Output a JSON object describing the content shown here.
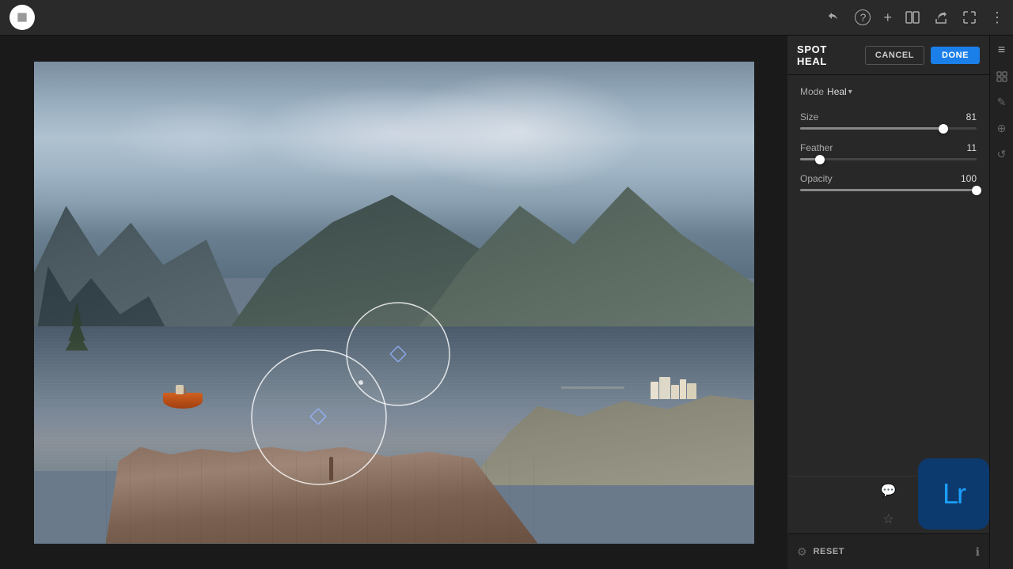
{
  "topBar": {
    "undo_icon": "↩",
    "help_icon": "?",
    "add_icon": "+",
    "compare_icon": "⊡",
    "share_icon": "↑",
    "expand_icon": "⤢",
    "more_icon": "⋮"
  },
  "panel": {
    "toolTitle": "SPOT HEAL",
    "cancelLabel": "CANCEL",
    "doneLabel": "DONE",
    "modeLabel": "Mode",
    "modeValue": "Heal",
    "controls": [
      {
        "id": "size",
        "label": "Size",
        "value": 81,
        "max": 100,
        "percent": 81
      },
      {
        "id": "feather",
        "label": "Feather",
        "value": 11,
        "max": 100,
        "percent": 11
      },
      {
        "id": "opacity",
        "label": "Opacity",
        "value": 100,
        "max": 100,
        "percent": 100
      }
    ],
    "resetLabel": "RESET"
  },
  "verticalIcons": [
    "⬡",
    "⇄",
    "✏",
    "⊕",
    "↻",
    "💬",
    "★",
    "ℹ"
  ],
  "lrBadge": {
    "text": "Lr"
  },
  "footer": {
    "leftIcon": "⚙",
    "resetLabel": "RESET",
    "infoIcon": "ℹ"
  }
}
